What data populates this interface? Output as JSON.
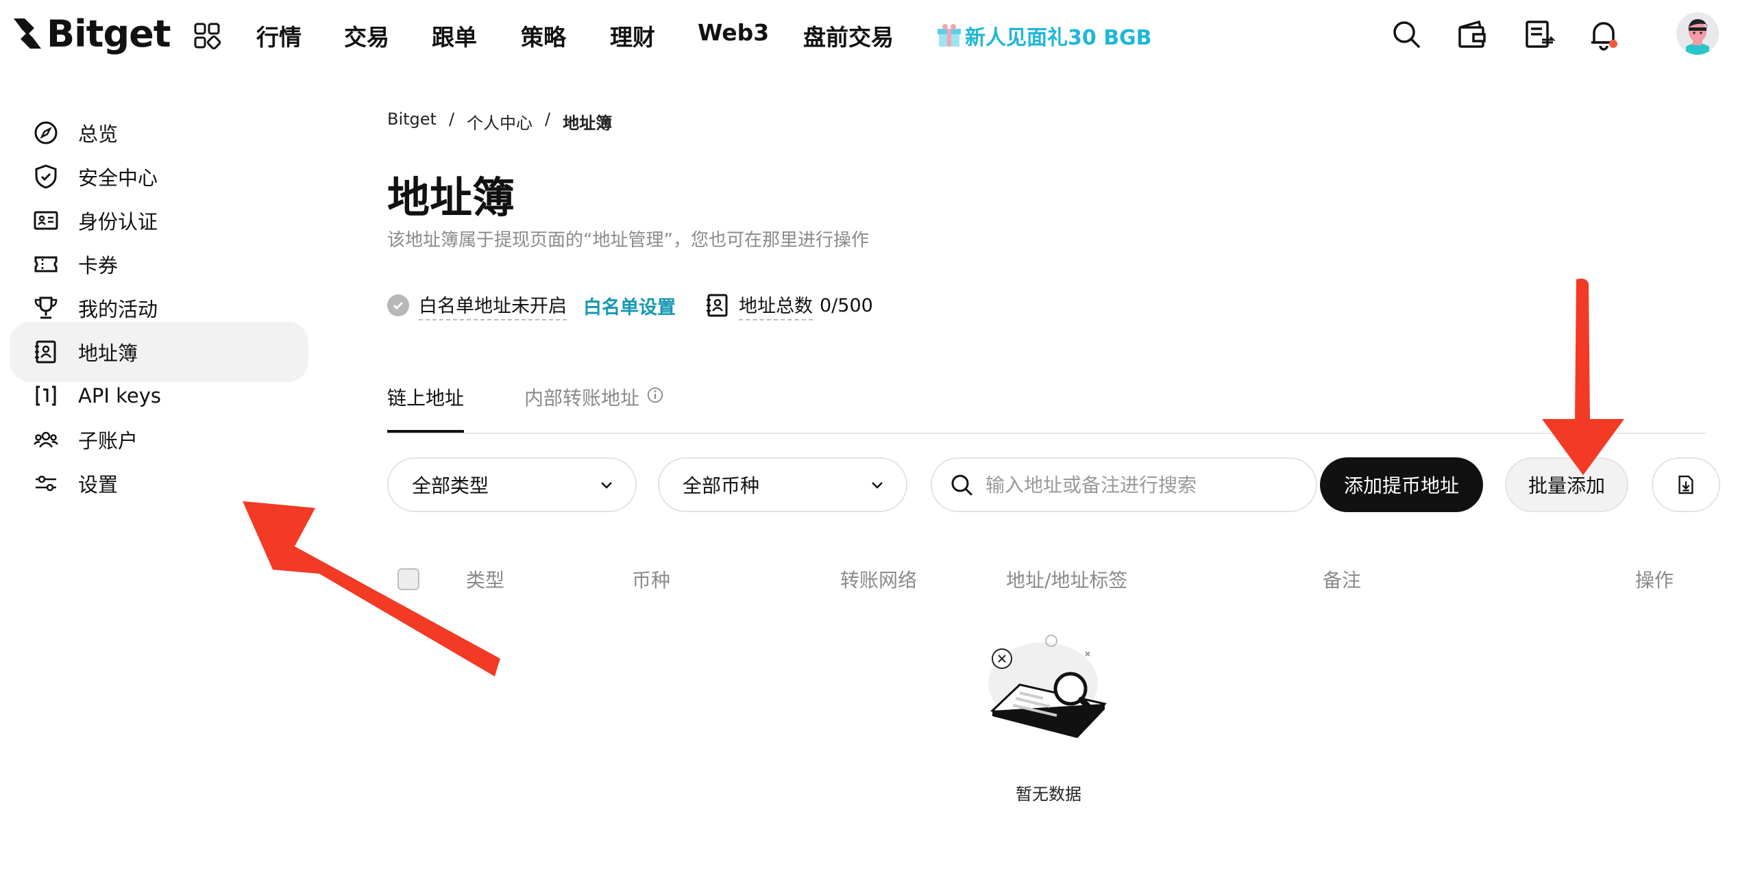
{
  "brand": {
    "name": "Bitget"
  },
  "nav": {
    "items": [
      "行情",
      "交易",
      "跟单",
      "策略",
      "理财",
      "Web3",
      "盘前交易"
    ],
    "promo": "新人见面礼30 BGB"
  },
  "sidebar": {
    "items": [
      {
        "label": "总览",
        "icon": "compass-icon"
      },
      {
        "label": "安全中心",
        "icon": "shield-icon"
      },
      {
        "label": "身份认证",
        "icon": "id-card-icon"
      },
      {
        "label": "卡券",
        "icon": "ticket-icon"
      },
      {
        "label": "我的活动",
        "icon": "trophy-icon"
      },
      {
        "label": "地址簿",
        "icon": "address-book-icon",
        "active": true
      },
      {
        "label": "API keys",
        "icon": "api-icon"
      },
      {
        "label": "子账户",
        "icon": "users-icon"
      },
      {
        "label": "设置",
        "icon": "sliders-icon"
      }
    ]
  },
  "breadcrumb": {
    "items": [
      "Bitget",
      "个人中心",
      "地址簿"
    ],
    "separator": "/"
  },
  "page": {
    "title": "地址簿",
    "description": "该地址簿属于提现页面的“地址管理”，您也可在那里进行操作"
  },
  "status": {
    "whitelist_text": "白名单地址未开启",
    "whitelist_link": "白名单设置",
    "count_label": "地址总数",
    "count_value": "0/500"
  },
  "tabs": {
    "items": [
      "链上地址",
      "内部转账地址"
    ],
    "active": 0
  },
  "filters": {
    "type_select": "全部类型",
    "coin_select": "全部币种",
    "search_placeholder": "输入地址或备注进行搜索",
    "add_button": "添加提币地址",
    "batch_button": "批量添加"
  },
  "table": {
    "columns": [
      "类型",
      "币种",
      "转账网络",
      "地址/地址标签",
      "备注",
      "操作"
    ],
    "rows": [],
    "empty_text": "暂无数据"
  },
  "colors": {
    "accent_teal": "#1698b4",
    "promo_teal": "#1fb6d8",
    "annotation_red": "#f23a24",
    "dark_button": "#111111"
  }
}
